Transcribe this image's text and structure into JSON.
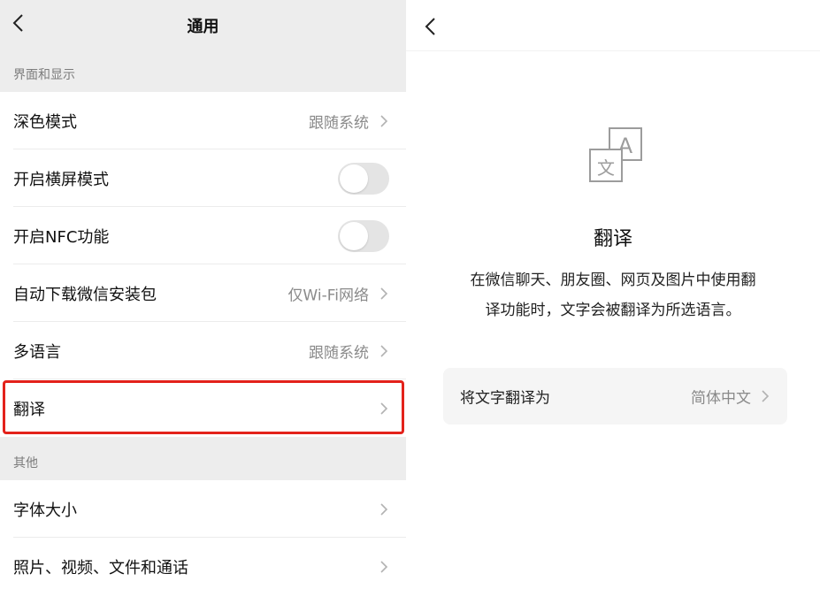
{
  "left": {
    "nav": {
      "title": "通用"
    },
    "sections": [
      {
        "header": "界面和显示",
        "rows": [
          {
            "label": "深色模式",
            "value": "跟随系统",
            "type": "link"
          },
          {
            "label": "开启横屏模式",
            "type": "toggle",
            "on": false
          },
          {
            "label": "开启NFC功能",
            "type": "toggle",
            "on": false
          },
          {
            "label": "自动下载微信安装包",
            "value": "仅Wi-Fi网络",
            "type": "link"
          },
          {
            "label": "多语言",
            "value": "跟随系统",
            "type": "link"
          },
          {
            "label": "翻译",
            "value": "",
            "type": "link",
            "highlighted": true
          }
        ]
      },
      {
        "header": "其他",
        "rows": [
          {
            "label": "字体大小",
            "value": "",
            "type": "link"
          },
          {
            "label": "照片、视频、文件和通话",
            "value": "",
            "type": "link"
          }
        ]
      }
    ]
  },
  "right": {
    "title": "翻译",
    "description_line1": "在微信聊天、朋友圈、网页及图片中使用翻",
    "description_line2": "译功能时，文字会被翻译为所选语言。",
    "icon": {
      "name": "translate-icon",
      "glyph_a": "A",
      "glyph_wen": "文"
    },
    "setting": {
      "label": "将文字翻译为",
      "value": "简体中文"
    }
  },
  "colors": {
    "background_gray": "#ededed",
    "highlight_red": "#e3221b",
    "secondary_text": "#8a8a8a"
  }
}
